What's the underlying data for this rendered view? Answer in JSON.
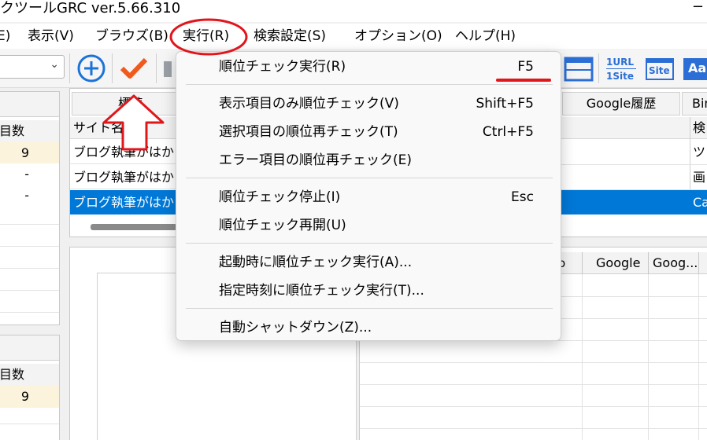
{
  "title_bar": {
    "title": "クツールGRC  ver.5.66.310",
    "close_glyph": "−"
  },
  "menubar": {
    "items": [
      "E)",
      "表示(V)",
      "ブラウズ(B)",
      "実行(R)",
      "検索設定(S)",
      "オプション(O)",
      "ヘルプ(H)"
    ],
    "active_index": 3
  },
  "toolbar": {
    "icons": [
      "add-circle-icon",
      "check-run-icon",
      "stop-icon",
      "window-layout-icon",
      "1url-1site-icon",
      "site-icon",
      "aa-icon"
    ],
    "url_icon_top": "1URL",
    "url_icon_bottom": "1Site",
    "site_icon_text": "Site",
    "aa_icon_text": "Aa"
  },
  "left_top_panel": {
    "header": "目数",
    "values": [
      "9",
      "-",
      "-"
    ]
  },
  "left_bottom_panel": {
    "header": "目数",
    "values": [
      "9"
    ]
  },
  "center_panel": {
    "tab_label": "標準",
    "column_header": "サイト名",
    "rows": [
      "ブログ執筆がはかど",
      "ブログ執筆がはかど",
      "ブログ執筆がはかど"
    ],
    "selected_row": 2
  },
  "right_panel": {
    "tabs": [
      "Google履歴",
      "Bin"
    ],
    "column_header": "検",
    "cells": [
      "ツ",
      "画",
      "Ca"
    ],
    "graph_headers": [
      "o",
      "Google",
      "Goog..."
    ]
  },
  "dropdown": {
    "groups": [
      [
        {
          "label": "順位チェック実行(R)",
          "shortcut": "F5"
        }
      ],
      [
        {
          "label": "表示項目のみ順位チェック(V)",
          "shortcut": "Shift+F5"
        },
        {
          "label": "選択項目の順位再チェック(T)",
          "shortcut": "Ctrl+F5"
        },
        {
          "label": "エラー項目の順位再チェック(E)",
          "shortcut": ""
        }
      ],
      [
        {
          "label": "順位チェック停止(I)",
          "shortcut": "Esc"
        },
        {
          "label": "順位チェック再開(U)",
          "shortcut": ""
        }
      ],
      [
        {
          "label": "起動時に順位チェック実行(A)...",
          "shortcut": ""
        },
        {
          "label": "指定時刻に順位チェック実行(T)...",
          "shortcut": ""
        }
      ],
      [
        {
          "label": "自動シャットダウン(Z)...",
          "shortcut": ""
        }
      ]
    ]
  },
  "annotations": {
    "circle_color": "#e0161c",
    "arrow_color": "#e0161c",
    "underline_color": "#e0161c"
  },
  "colors": {
    "selection": "#0078d7",
    "accent_blue": "#1a73d9",
    "check_orange": "#f05a1c",
    "icon_blue": "#2b6fd6"
  }
}
